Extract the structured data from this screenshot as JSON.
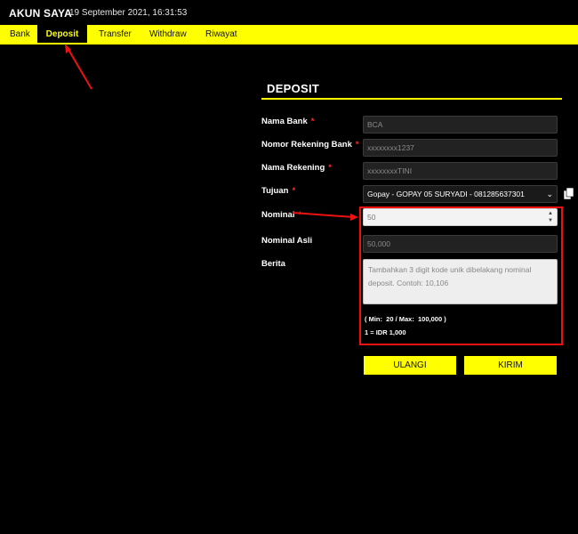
{
  "app": {
    "title": "AKUN SAYA",
    "datetime": "19 September 2021, 16:31:53"
  },
  "nav": {
    "tabs": [
      "Bank",
      "Deposit",
      "Transfer",
      "Withdraw",
      "Riwayat"
    ],
    "active": "Deposit"
  },
  "form": {
    "title": "DEPOSIT",
    "required_mark": "*",
    "labels": {
      "nama_bank": "Nama Bank",
      "nomor_rekening_bank": "Nomor Rekening Bank",
      "nama_rekening": "Nama Rekening",
      "tujuan": "Tujuan",
      "nominal": "Nominal",
      "nominal_asli": "Nominal Asli",
      "berita": "Berita"
    },
    "values": {
      "nama_bank": "BCA",
      "nomor_rekening_bank": "xxxxxxxx1237",
      "nama_rekening": "xxxxxxxxTINI",
      "tujuan": "Gopay - GOPAY 05 SURYADI - 081285637301",
      "nominal": "50",
      "nominal_asli": "50,000"
    },
    "berita_placeholder": "Tambahkan 3 digit kode unik dibelakang nominal deposit. Contoh: 10,106",
    "min_max_note": "( Min:  20 / Max:  100,000 )",
    "rate_note": "1 = IDR 1,000",
    "buttons": {
      "reset": "ULANGI",
      "submit": "KIRIM"
    }
  },
  "colors": {
    "accent": "#ffff00",
    "background": "#000000",
    "highlight": "#ee1111"
  }
}
